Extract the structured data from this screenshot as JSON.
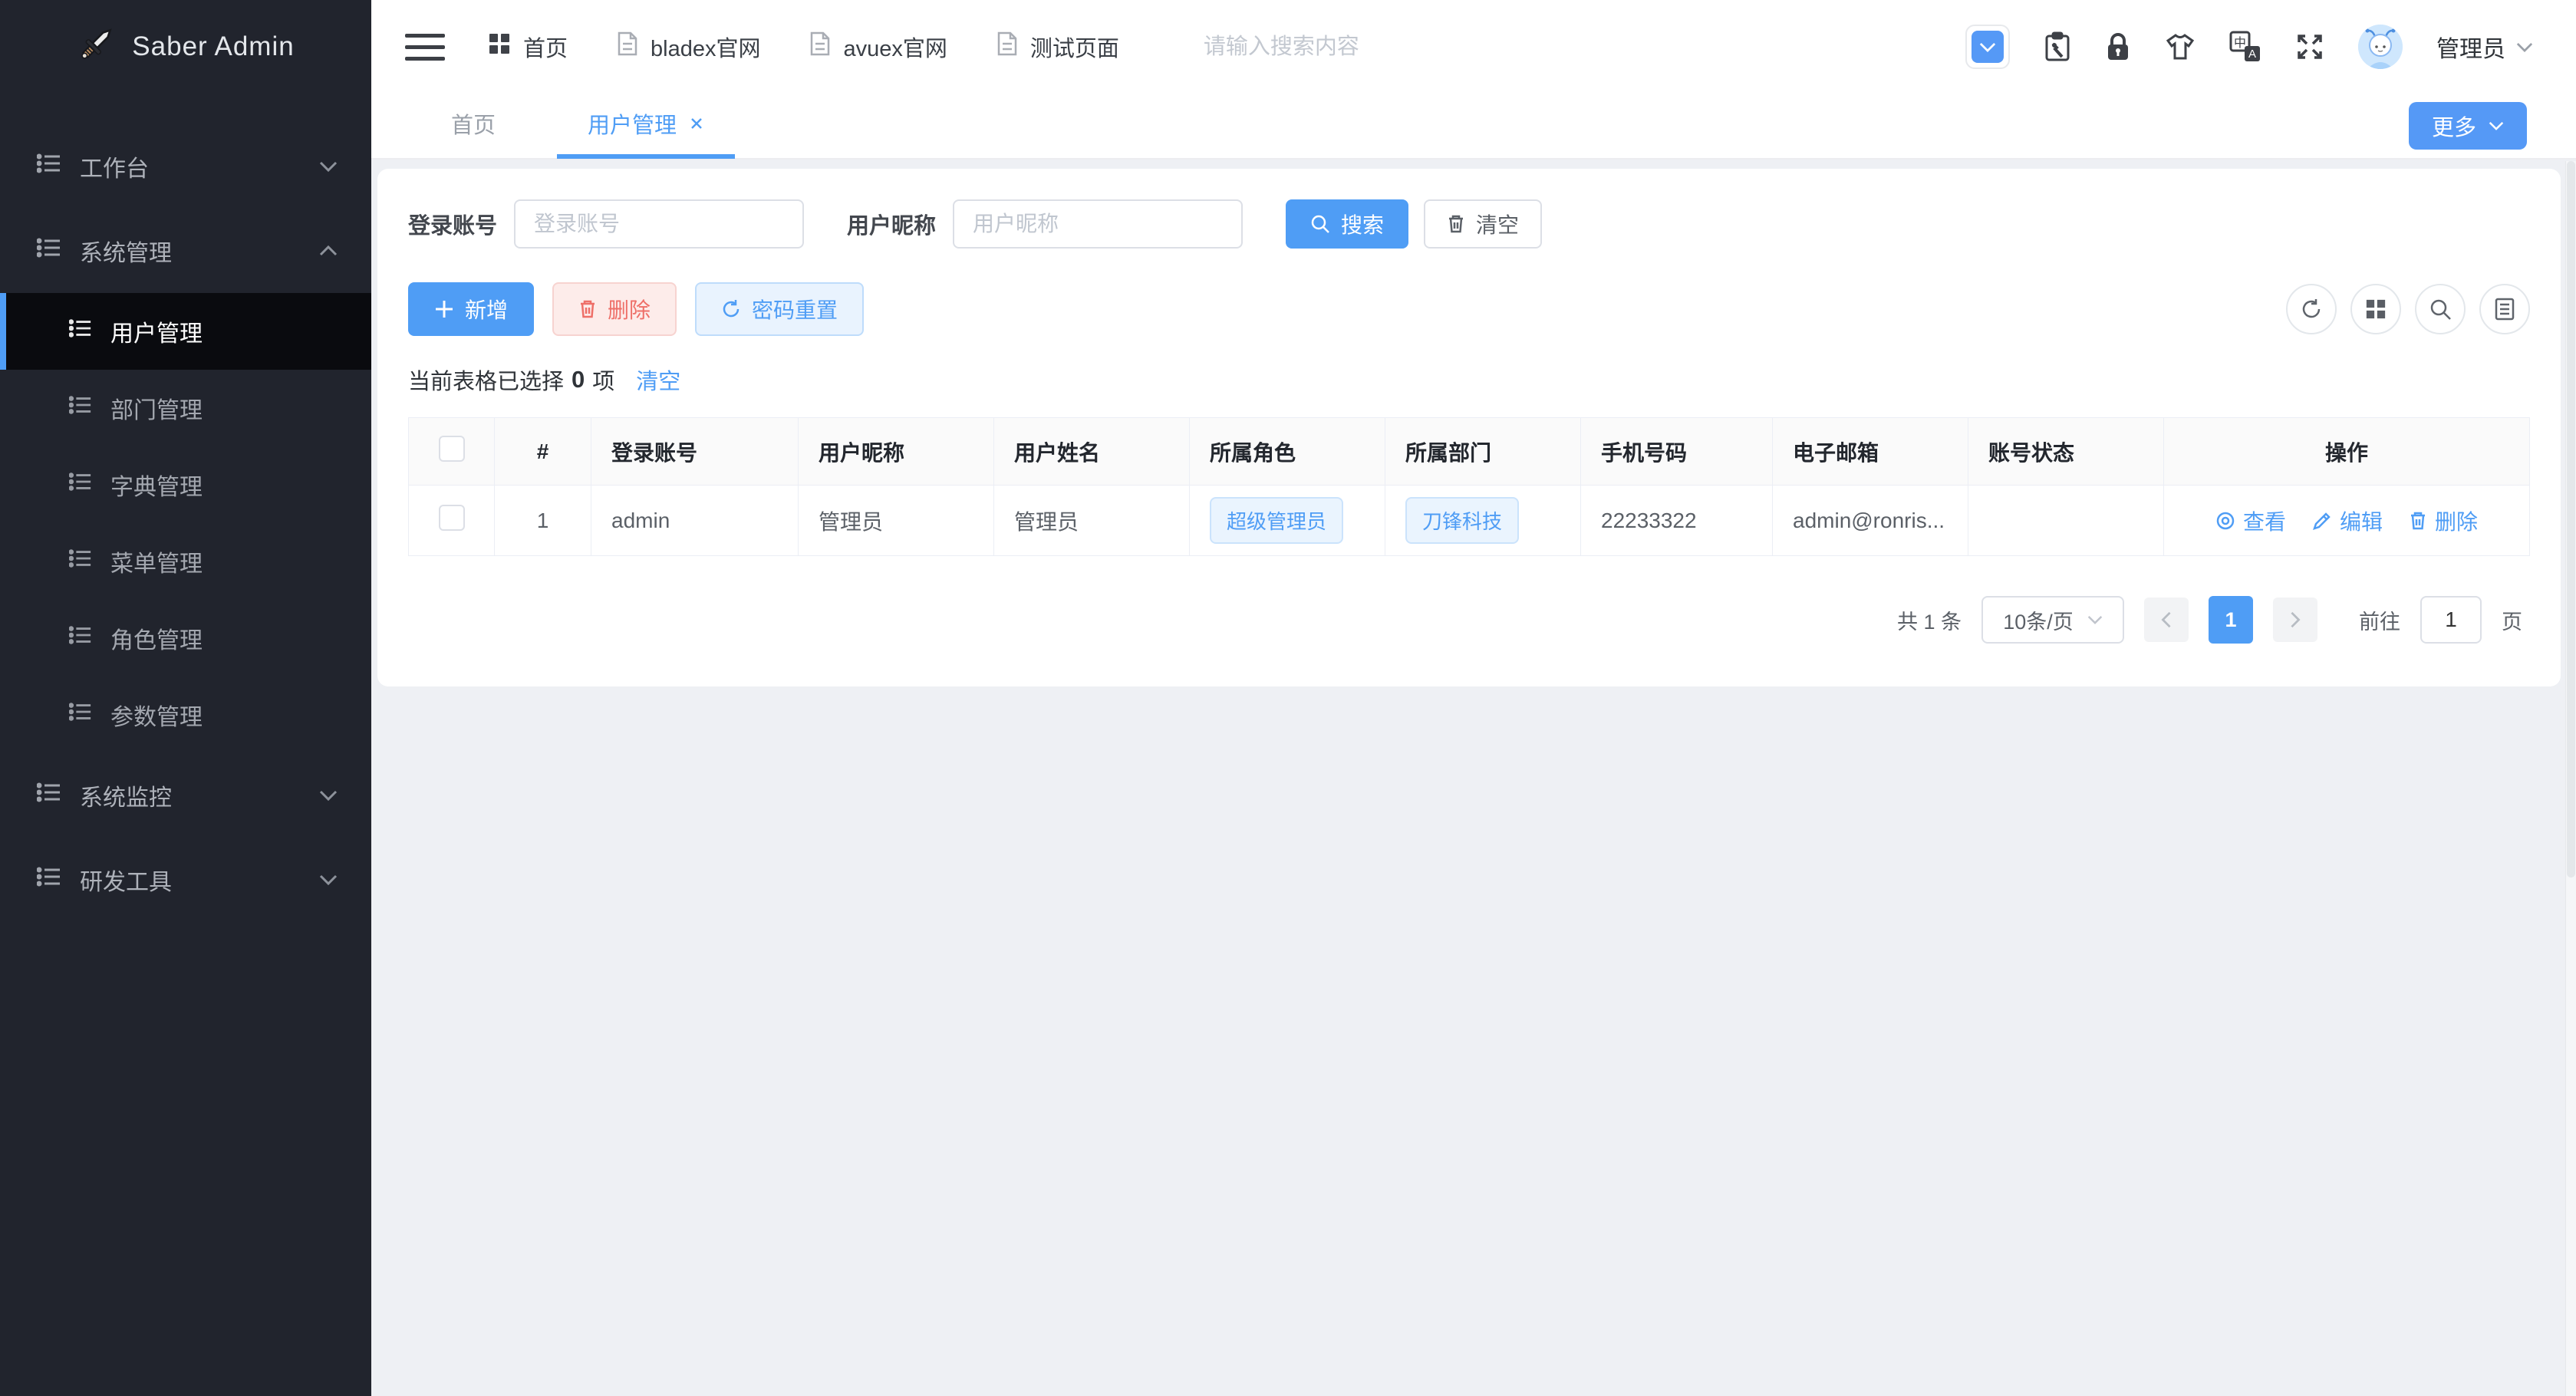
{
  "app": {
    "title": "Saber Admin"
  },
  "colors": {
    "primary": "#4f9df5",
    "danger": "#ee6f68",
    "sidebar_bg": "#21242d",
    "active_item_bg": "#0a0b0f",
    "content_bg": "#eef0f4",
    "tag_bg": "#eaf4fe"
  },
  "sidebar": {
    "groups": [
      {
        "label": "工作台",
        "state": "collapsed"
      },
      {
        "label": "系统管理",
        "state": "expanded"
      },
      {
        "label": "系统监控",
        "state": "collapsed"
      },
      {
        "label": "研发工具",
        "state": "collapsed"
      }
    ],
    "system_children": [
      {
        "label": "用户管理",
        "active": true
      },
      {
        "label": "部门管理"
      },
      {
        "label": "字典管理"
      },
      {
        "label": "菜单管理"
      },
      {
        "label": "角色管理"
      },
      {
        "label": "参数管理"
      }
    ]
  },
  "topbar": {
    "nav": [
      {
        "label": "首页",
        "icon": "grid-icon"
      },
      {
        "label": "bladex官网",
        "icon": "document-icon"
      },
      {
        "label": "avuex官网",
        "icon": "document-icon"
      },
      {
        "label": "测试页面",
        "icon": "document-icon"
      }
    ],
    "search_placeholder": "请输入搜索内容",
    "username": "管理员"
  },
  "tabs": {
    "items": [
      {
        "label": "首页",
        "active": false,
        "closable": false
      },
      {
        "label": "用户管理",
        "active": true,
        "closable": true
      }
    ],
    "more_label": "更多"
  },
  "filters": {
    "account_label": "登录账号",
    "account_placeholder": "登录账号",
    "nickname_label": "用户昵称",
    "nickname_placeholder": "用户昵称",
    "search_label": "搜索",
    "clear_label": "清空"
  },
  "crud_buttons": {
    "add": "新增",
    "delete": "删除",
    "reset_password": "密码重置"
  },
  "selection": {
    "before": "当前表格已选择",
    "count": "0",
    "after": "项",
    "clear_label": "清空"
  },
  "table": {
    "columns": [
      "#",
      "登录账号",
      "用户昵称",
      "用户姓名",
      "所属角色",
      "所属部门",
      "手机号码",
      "电子邮箱",
      "账号状态",
      "操作"
    ],
    "row": {
      "index": "1",
      "account": "admin",
      "nickname": "管理员",
      "name": "管理员",
      "role": "超级管理员",
      "dept": "刀锋科技",
      "phone": "22233322",
      "email": "admin@ronris...",
      "status": "",
      "view_label": "查看",
      "edit_label": "编辑",
      "delete_label": "删除"
    }
  },
  "pagination": {
    "total": "共 1 条",
    "page_size": "10条/页",
    "current_page": "1",
    "goto_label": "前往",
    "goto_value": "1",
    "goto_unit": "页"
  }
}
